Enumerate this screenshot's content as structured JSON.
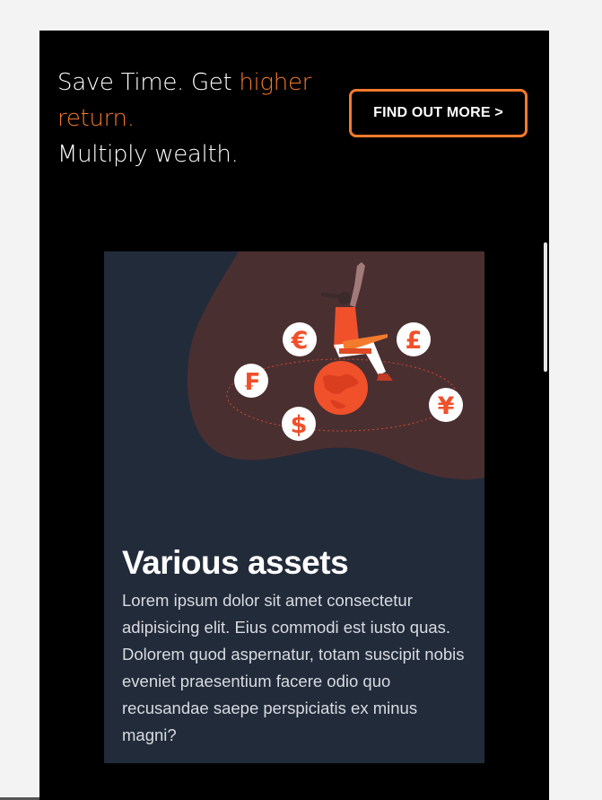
{
  "hero": {
    "line1_part1": "Save Time. Get ",
    "line1_accent": "higher",
    "line2_accent": "return.",
    "line3": "Multiply wealth.",
    "accent_color": "#f47a2c"
  },
  "cta": {
    "label": "FIND OUT MORE >"
  },
  "card": {
    "title": "Various assets",
    "body": "Lorem ipsum dolor sit amet consectetur adipisicing elit. Eius commodi est iusto quas. Dolorem quod aspernatur, totam suscipit nobis eveniet praesentium facere odio quo recusandae saepe perspiciatis ex minus magni?",
    "illustration": {
      "currency_icons": [
        "euro-icon",
        "pound-icon",
        "franc-icon",
        "dollar-icon",
        "yen-icon"
      ],
      "glyphs": {
        "euro": "€",
        "pound": "£",
        "franc": "₣",
        "dollar": "$",
        "yen": "¥"
      },
      "icon_color": "#f0502a",
      "blob_color": "#4a2f31"
    }
  }
}
